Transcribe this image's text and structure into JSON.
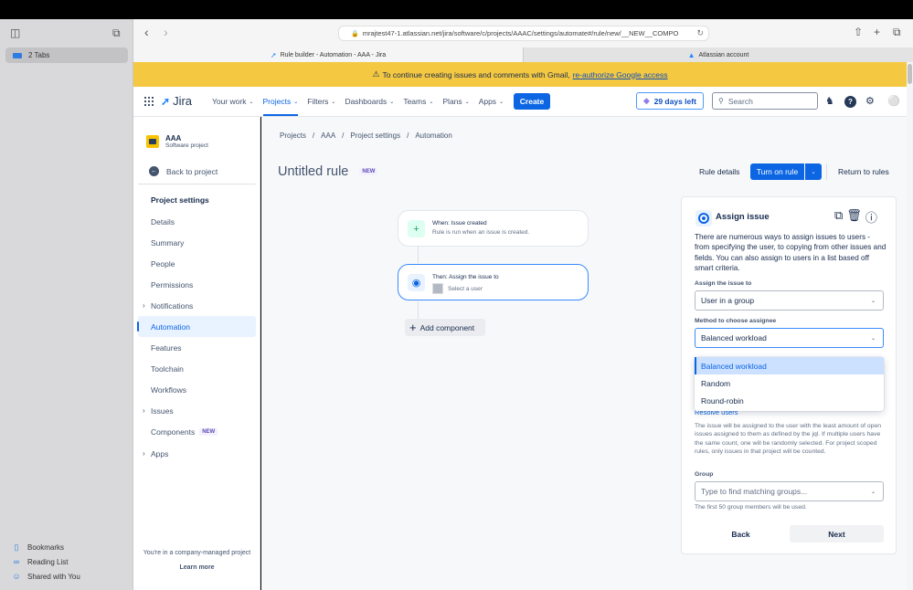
{
  "browser": {
    "sidebar": {
      "tabs_label": "2 Tabs",
      "bookmarks": "Bookmarks",
      "reading_list": "Reading List",
      "shared_with_you": "Shared with You"
    },
    "url": "mrajtest47-1.atlassian.net/jira/software/c/projects/AAAC/settings/automate#/rule/new/__NEW__COMPO",
    "tabs": [
      {
        "label": "Rule builder - Automation - AAA - Jira",
        "active": true
      },
      {
        "label": "Atlassian account",
        "active": false
      }
    ]
  },
  "banner": {
    "text": "To continue creating issues and comments with Gmail,",
    "link": "re-authorize Google access",
    "color": "#f5c842"
  },
  "header": {
    "product": "Jira",
    "menu": [
      {
        "label": "Your work",
        "active": false
      },
      {
        "label": "Projects",
        "active": true
      },
      {
        "label": "Filters",
        "active": false
      },
      {
        "label": "Dashboards",
        "active": false
      },
      {
        "label": "Teams",
        "active": false
      },
      {
        "label": "Plans",
        "active": false
      },
      {
        "label": "Apps",
        "active": false
      }
    ],
    "create_label": "Create",
    "trial_label": "29 days left",
    "search_placeholder": "Search",
    "accent": "#0c66e4"
  },
  "project": {
    "name": "AAA",
    "type": "Software project",
    "back_label": "Back to project",
    "section_heading": "Project settings",
    "items": [
      {
        "label": "Details",
        "expandable": false,
        "active": false
      },
      {
        "label": "Summary",
        "expandable": false,
        "active": false
      },
      {
        "label": "People",
        "expandable": false,
        "active": false
      },
      {
        "label": "Permissions",
        "expandable": false,
        "active": false
      },
      {
        "label": "Notifications",
        "expandable": true,
        "active": false
      },
      {
        "label": "Automation",
        "expandable": false,
        "active": true
      },
      {
        "label": "Features",
        "expandable": false,
        "active": false
      },
      {
        "label": "Toolchain",
        "expandable": false,
        "active": false
      },
      {
        "label": "Workflows",
        "expandable": false,
        "active": false
      },
      {
        "label": "Issues",
        "expandable": true,
        "active": false
      },
      {
        "label": "Components",
        "expandable": false,
        "active": false,
        "badge": "NEW"
      },
      {
        "label": "Apps",
        "expandable": true,
        "active": false
      }
    ],
    "footer_text": "You're in a company-managed project",
    "footer_link": "Learn more"
  },
  "page": {
    "breadcrumb": [
      "Projects",
      "AAA",
      "Project settings",
      "Automation"
    ],
    "title": "Untitled rule",
    "title_badge": "NEW",
    "rule_details": "Rule details",
    "turn_on": "Turn on rule",
    "return": "Return to rules"
  },
  "flow": {
    "trigger": {
      "title": "When: Issue created",
      "subtitle": "Rule is run when an issue is created."
    },
    "action": {
      "title": "Then: Assign the issue to",
      "subtitle": "Select a user"
    },
    "add_component": "Add component"
  },
  "panel": {
    "title": "Assign issue",
    "description": "There are numerous ways to assign issues to users - from specifying the user, to copying from other issues and fields. You can also assign to users in a list based off smart criteria.",
    "assign_label": "Assign the issue to",
    "assign_value": "User in a group",
    "method_label": "Method to choose assignee",
    "method_value": "Balanced workload",
    "method_options": [
      "Balanced workload",
      "Random",
      "Round-robin"
    ],
    "resolve_link": "Resolve users",
    "help_text": "The issue will be assigned to the user with the least amount of open issues assigned to them as defined by the jql. If multiple users have the same count, one will be randomly selected. For project scoped rules, only issues in that project will be counted.",
    "group_label": "Group",
    "group_placeholder": "Type to find matching groups...",
    "group_hint": "The first 50 group members will be used.",
    "back_label": "Back",
    "next_label": "Next"
  }
}
